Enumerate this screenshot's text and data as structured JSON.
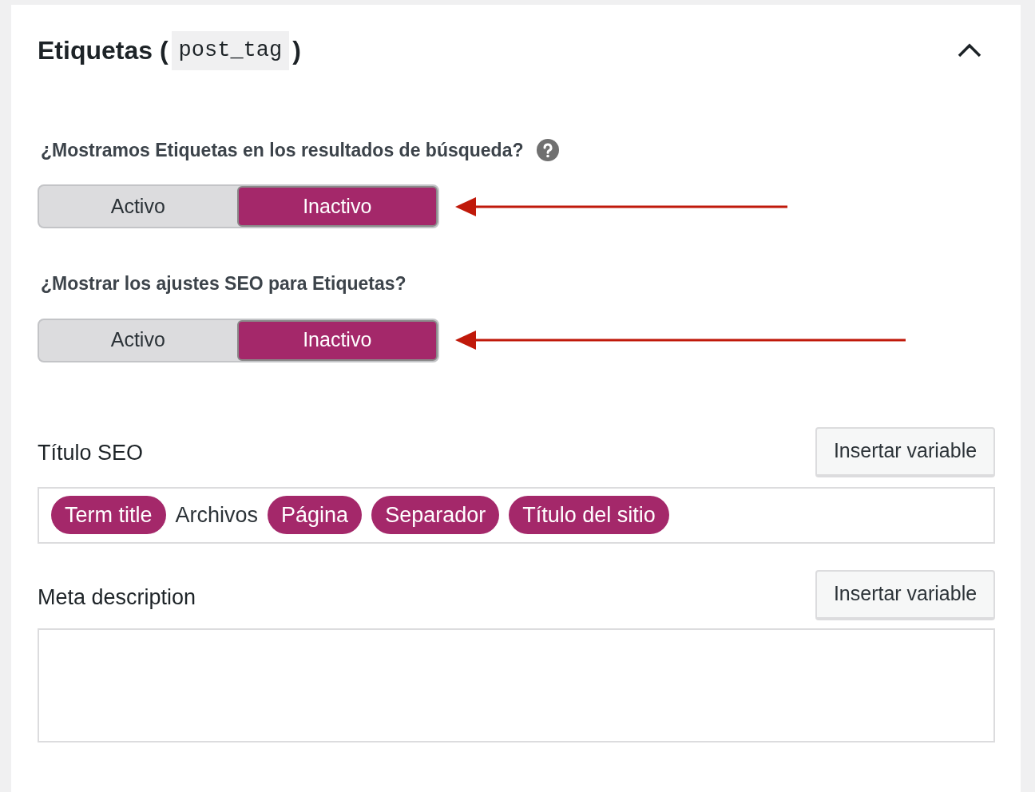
{
  "panel": {
    "title_prefix": "Etiquetas (",
    "title_code": "post_tag",
    "title_suffix": ")",
    "expanded": true
  },
  "toggles": [
    {
      "question": "¿Mostramos Etiquetas en los resultados de búsqueda?",
      "has_help": true,
      "options": [
        {
          "label": "Activo",
          "selected": false
        },
        {
          "label": "Inactivo",
          "selected": true
        }
      ]
    },
    {
      "question": "¿Mostrar los ajustes SEO para Etiquetas?",
      "has_help": false,
      "options": [
        {
          "label": "Activo",
          "selected": false
        },
        {
          "label": "Inactivo",
          "selected": true
        }
      ]
    }
  ],
  "seo_title": {
    "label": "Título SEO",
    "button": "Insertar variable",
    "tokens": [
      {
        "kind": "variable",
        "text": "Term title"
      },
      {
        "kind": "text",
        "text": "Archivos"
      },
      {
        "kind": "variable",
        "text": "Página"
      },
      {
        "kind": "variable",
        "text": "Separador"
      },
      {
        "kind": "variable",
        "text": "Título del sitio"
      }
    ]
  },
  "meta_description": {
    "label": "Meta description",
    "button": "Insertar variable"
  }
}
